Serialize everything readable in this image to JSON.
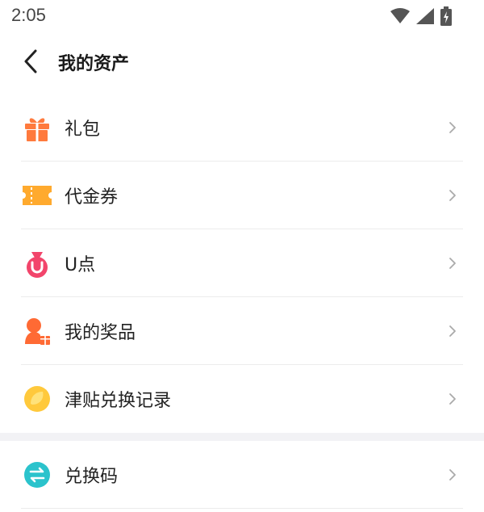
{
  "status_bar": {
    "time": "2:05",
    "icons": [
      "wifi-icon",
      "signal-icon",
      "battery-icon"
    ]
  },
  "header": {
    "title": "我的资产",
    "back_icon": "chevron-left-icon"
  },
  "menu": {
    "items": [
      {
        "label": "礼包",
        "icon": "gift-icon",
        "color": "#FF7A3D"
      },
      {
        "label": "代金券",
        "icon": "voucher-icon",
        "color": "#FFAA2E"
      },
      {
        "label": "U点",
        "icon": "u-point-bag-icon",
        "color": "#F2456B"
      },
      {
        "label": "我的奖品",
        "icon": "prize-user-icon",
        "color": "#FF6A34"
      },
      {
        "label": "津贴兑换记录",
        "icon": "allowance-coin-icon",
        "color": "#FFC93C"
      }
    ]
  },
  "menu2": {
    "items": [
      {
        "label": "兑换码",
        "icon": "exchange-code-icon",
        "color": "#2BC3CC"
      }
    ]
  }
}
